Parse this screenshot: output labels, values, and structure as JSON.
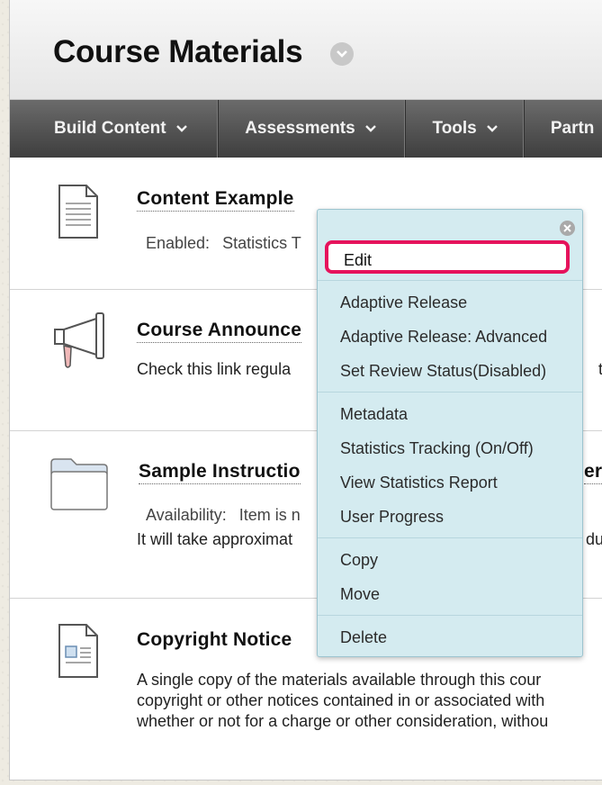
{
  "page_title": "Course Materials",
  "nav": {
    "build_content": "Build Content",
    "assessments": "Assessments",
    "tools": "Tools",
    "partner": "Partn"
  },
  "items": {
    "content_example": {
      "title": "Content Example",
      "meta_key": "Enabled:",
      "meta_value": "Statistics T",
      "icon": "document-icon"
    },
    "announcements": {
      "title": "Course Announce",
      "desc": "Check this link regula",
      "desc_right": "t",
      "icon": "megaphone-icon"
    },
    "sample": {
      "title": "Sample Instructio",
      "title_right": "ere",
      "meta_key": "Availability:",
      "meta_value": "Item is n",
      "desc": "It will take approximat",
      "desc_right": "du",
      "icon": "folder-icon"
    },
    "copyright": {
      "title": "Copyright Notice",
      "desc_lines": [
        "A single copy of the materials available through this cour",
        "copyright or other notices contained in or associated with",
        "whether or not for a charge or other consideration, withou"
      ],
      "icon": "page-icon"
    }
  },
  "menu": {
    "edit": "Edit",
    "group1": [
      "Adaptive Release",
      "Adaptive Release: Advanced",
      "Set Review Status(Disabled)"
    ],
    "group2": [
      "Metadata",
      "Statistics Tracking (On/Off)",
      "View Statistics Report",
      "User Progress"
    ],
    "group3": [
      "Copy",
      "Move"
    ],
    "group4": [
      "Delete"
    ]
  },
  "colors": {
    "highlight": "#e6135c",
    "menu_bg": "#d4ebf0",
    "nav_bg": "#4f4f4f"
  }
}
